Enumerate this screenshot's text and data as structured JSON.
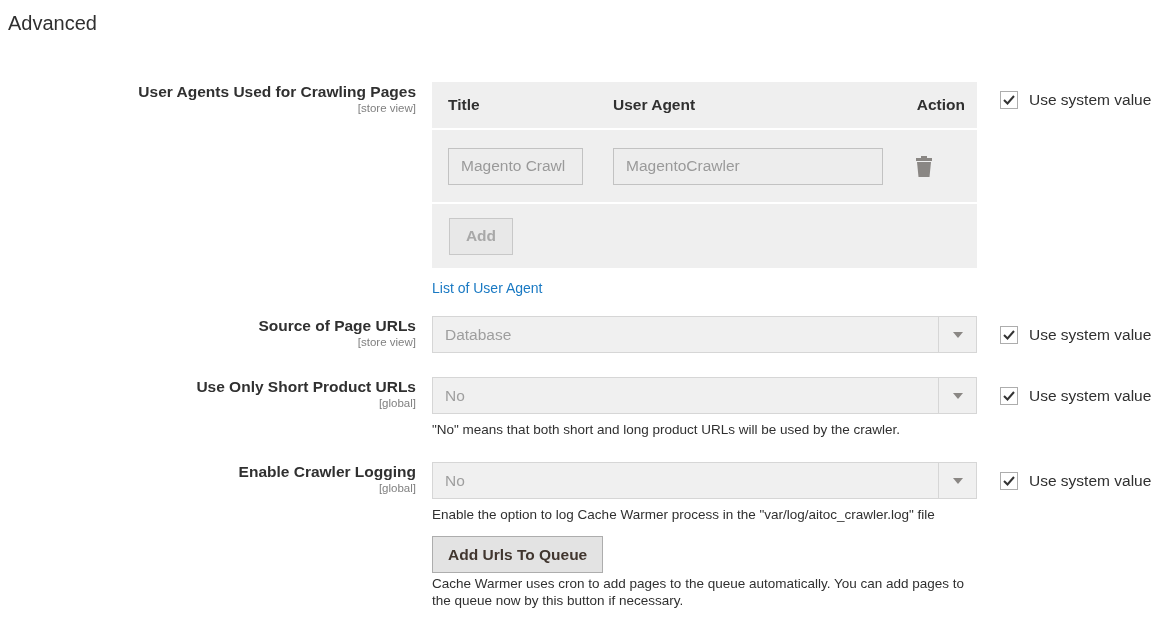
{
  "section_title": "Advanced",
  "fields": [
    {
      "kind": "grid",
      "label": "User Agents Used for Crawling Pages",
      "scope": "[store view]",
      "disabled": true,
      "use_system_value": {
        "label": "Use system value",
        "checked": true
      },
      "grid": {
        "columns": [
          "Title",
          "User Agent",
          "Action"
        ],
        "rows": [
          {
            "title": "Magento Crawl",
            "user_agent": "MagentoCrawler"
          }
        ],
        "add_button": "Add"
      },
      "link": "List of User Agent"
    },
    {
      "kind": "select",
      "label": "Source of Page URLs",
      "scope": "[store view]",
      "disabled": true,
      "value": "Database",
      "use_system_value": {
        "label": "Use system value",
        "checked": true
      }
    },
    {
      "kind": "select",
      "label": "Use Only Short Product URLs",
      "scope": "[global]",
      "disabled": true,
      "value": "No",
      "use_system_value": {
        "label": "Use system value",
        "checked": true
      },
      "comment": "\"No\" means that both short and long product URLs will be used by the crawler."
    },
    {
      "kind": "select",
      "label": "Enable Crawler Logging",
      "scope": "[global]",
      "disabled": true,
      "value": "No",
      "use_system_value": {
        "label": "Use system value",
        "checked": true
      },
      "comment": "Enable the option to log Cache Warmer process in the \"var/log/aitoc_crawler.log\" file",
      "button": "Add Urls To Queue",
      "button_comment": "Cache Warmer uses cron to add pages to the queue automatically. You can add pages to the queue now by this button if necessary."
    }
  ]
}
